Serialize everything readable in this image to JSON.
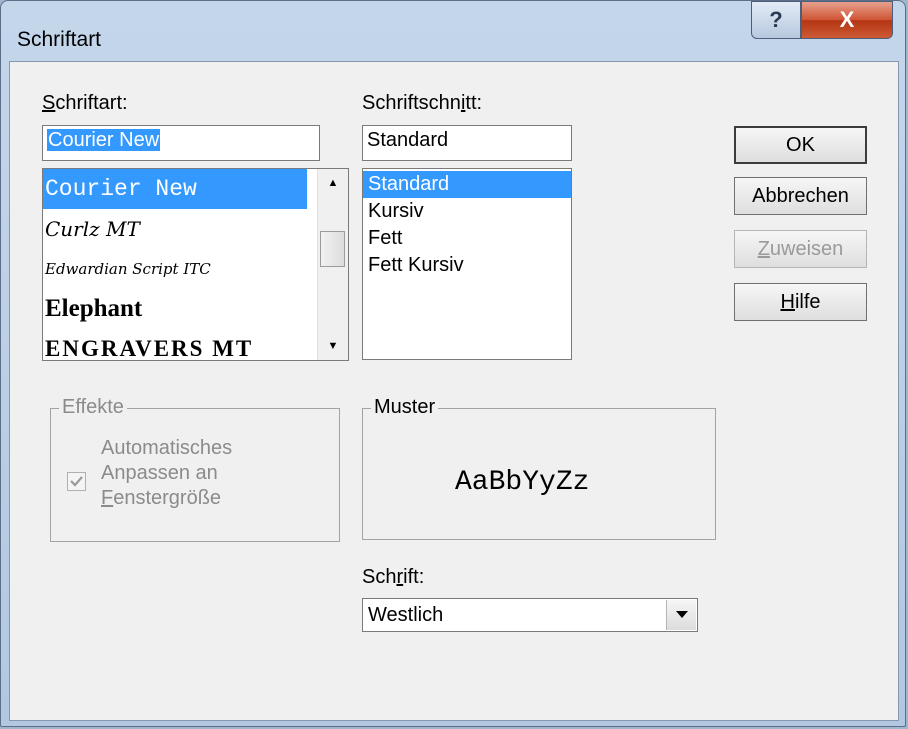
{
  "window": {
    "title": "Schriftart",
    "help_glyph": "?",
    "close_glyph": "X"
  },
  "font": {
    "label": "Schriftart:",
    "accesskey": "S",
    "label_rest": "chriftart:",
    "value": "Courier New",
    "items": [
      {
        "label": "Courier New",
        "selected": true
      },
      {
        "label": "Curlz MT",
        "selected": false
      },
      {
        "label": "Edwardian Script ITC",
        "selected": false
      },
      {
        "label": "Elephant",
        "selected": false
      },
      {
        "label": "ENGRAVERS MT",
        "selected": false
      }
    ]
  },
  "style": {
    "label_pre": "Schriftschn",
    "accesskey": "i",
    "label_post": "tt:",
    "value": "Standard",
    "items": [
      {
        "label": "Standard",
        "selected": true
      },
      {
        "label": "Kursiv",
        "selected": false
      },
      {
        "label": "Fett",
        "selected": false
      },
      {
        "label": "Fett Kursiv",
        "selected": false
      }
    ]
  },
  "buttons": {
    "ok": "OK",
    "cancel": "Abbrechen",
    "apply_key": "Z",
    "apply_rest": "uweisen",
    "help_key": "H",
    "help_rest": "ilfe"
  },
  "effects": {
    "legend": "Effekte",
    "line1": "Automatisches",
    "line2": "Anpassen an",
    "line3_key": "F",
    "line3_rest": "enstergröße",
    "checked": true
  },
  "sample": {
    "legend": "Muster",
    "text": "AaBbYyZz"
  },
  "script": {
    "label_pre": "Sch",
    "accesskey": "r",
    "label_post": "ift:",
    "value": "Westlich"
  },
  "colors": {
    "selection": "#3399ff",
    "close_button": "#c9452a"
  }
}
